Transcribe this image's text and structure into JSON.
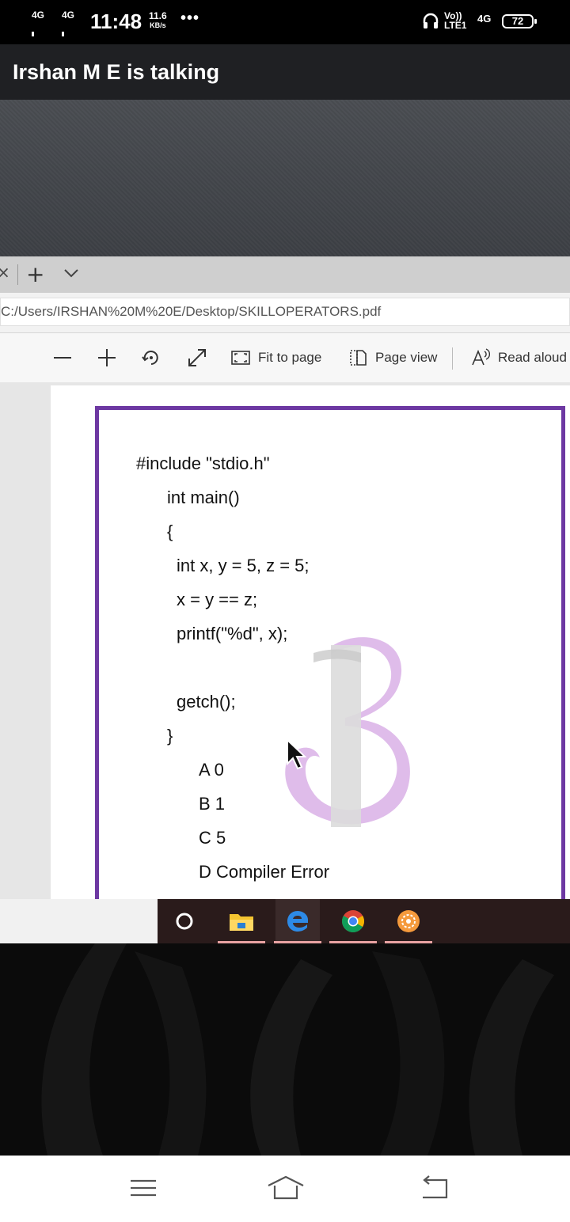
{
  "status_bar": {
    "network_1": "4G",
    "network_2": "4G",
    "time": "11:48",
    "speed_value": "11.6",
    "speed_unit": "KB/s",
    "more": "•••",
    "volte_top": "Vo))",
    "volte_bottom": "LTE1",
    "network_3": "4G",
    "battery": "72"
  },
  "call": {
    "title": "Irshan M E is talking"
  },
  "browser": {
    "tab_close": "×",
    "new_tab": "+",
    "url": "C:/Users/IRSHAN%20M%20E/Desktop/SKILLOPERATORS.pdf"
  },
  "pdf_toolbar": {
    "fit_to_page": "Fit to page",
    "page_view": "Page view",
    "read_aloud": "Read aloud"
  },
  "document": {
    "lines": [
      "#include \"stdio.h\"",
      "int main()",
      "{",
      "int x, y = 5, z = 5;",
      "x = y == z;",
      "printf(\"%d\", x);",
      "getch();",
      "}",
      "A 0",
      "B 1",
      "C 5",
      "D Compiler Error"
    ],
    "accent_color": "#6d38a2"
  },
  "taskbar": {
    "icons": [
      "cortana-icon",
      "file-explorer-icon",
      "edge-icon",
      "chrome-icon",
      "app-icon"
    ]
  },
  "colors": {
    "call_bar": "#1f2023",
    "taskbar_dark": "#2a1b1b"
  }
}
